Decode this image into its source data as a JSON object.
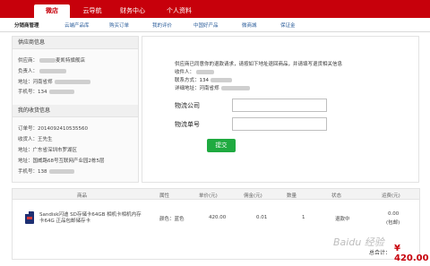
{
  "top_nav": {
    "tabs": [
      {
        "label": "微店",
        "active": true
      },
      {
        "label": "云导航",
        "active": false
      },
      {
        "label": "财务中心",
        "active": false
      },
      {
        "label": "个人资料",
        "active": false
      }
    ]
  },
  "sub_nav": {
    "items": [
      "分销商管理",
      "云端产品库",
      "购买订单",
      "我的评价",
      "中国好产品",
      "微商城",
      "保证金"
    ]
  },
  "supplier": {
    "header": "供应商信息",
    "company_label": "供应商：",
    "company_value": "麦凯特旗舰店",
    "contact_label": "负责人：",
    "address_label": "地址：",
    "address_value": "河南省郑",
    "phone_label": "手机号：",
    "phone_value": "134"
  },
  "buyer": {
    "header": "我的收货信息",
    "order_label": "订单号：",
    "order_value": "2014092410535560",
    "receiver_label": "收货人：",
    "receiver_value": "王先生",
    "region_label": "地址：",
    "region_value": "广东省深圳市罗湖区",
    "address_label": "地址：",
    "address_value": "国威路68号互联网产业园2栋5层",
    "phone_label": "手机号：",
    "phone_value": "138"
  },
  "return_info": {
    "notice": "供应商已同意你的退款请求，请按如下地址退回商品，并请填写退货相关信息",
    "receiver_label": "收件人：",
    "contact_label": "联系方式：",
    "contact_value": "134",
    "address_label": "详细地址：",
    "address_value": "河南省郑"
  },
  "form": {
    "company_label": "物流公司",
    "number_label": "物流单号",
    "company_value": "",
    "number_value": "",
    "submit_label": "提交"
  },
  "table": {
    "headers": [
      "商品",
      "属性",
      "单价(元)",
      "佣金(元)",
      "数量",
      "状态",
      "运费(元)"
    ],
    "rows": [
      {
        "product": "Sandisk闪迪 SD存储卡64GB 相机卡相机内存卡64G 正品包邮储存卡",
        "attribute": "颜色：蓝色",
        "price": "420.00",
        "commission": "0.01",
        "quantity": "1",
        "status": "退款中",
        "shipping": "0.00",
        "shipping_note": "(包邮)"
      }
    ]
  },
  "summary": {
    "total_label": "总合计：",
    "total_value": "¥ 420.00"
  },
  "colors": {
    "brand_red": "#c7000b",
    "link_blue": "#2a5c9a",
    "submit_green": "#1faa40"
  },
  "watermark": "Baidu 经验"
}
